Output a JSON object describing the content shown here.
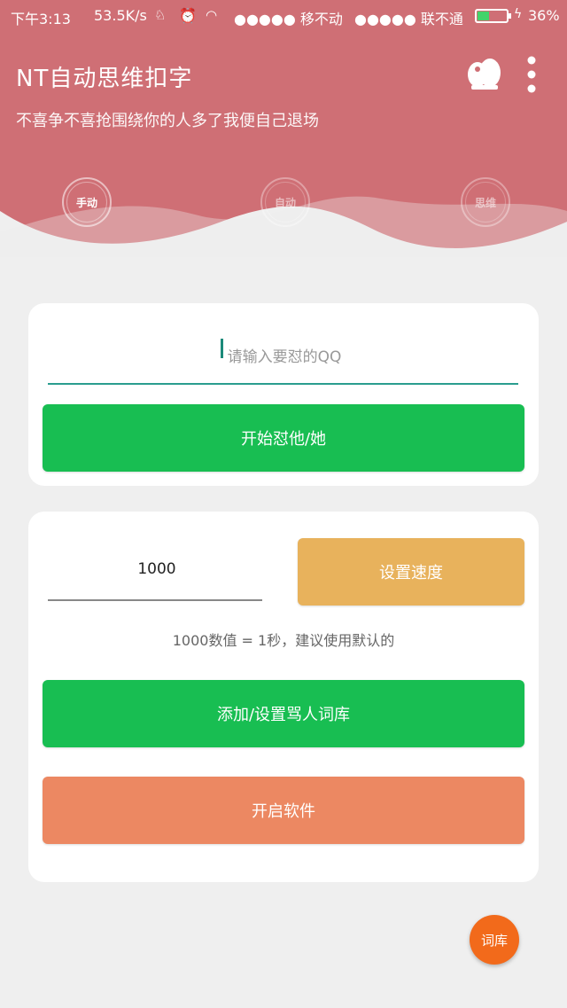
{
  "status_bar": {
    "time": "下午3:13",
    "speed": "53.5K/s",
    "carrier1": "●●●●● 移不动",
    "carrier2": "●●●●● 联不通",
    "battery": "36%"
  },
  "header": {
    "title": "NT自动思维扣字",
    "subtitle": "不喜争不喜抢围绕你的人多了我便自己退场",
    "modes": [
      {
        "label": "手动",
        "active": true
      },
      {
        "label": "自动",
        "active": false
      },
      {
        "label": "思维",
        "active": false
      }
    ],
    "icons": [
      "qq-icon",
      "more-vertical-icon"
    ]
  },
  "card1": {
    "qq_placeholder": "请输入要怼的QQ",
    "start_button": "开始怼他/她"
  },
  "card2": {
    "speed_value": "1000",
    "set_speed_button": "设置速度",
    "hint": "1000数值 = 1秒，建议使用默认的",
    "words_button": "添加/设置骂人词库",
    "start_app_button": "开启软件"
  },
  "fab": {
    "label": "词库"
  },
  "colors": {
    "header": "#cf6f75",
    "green": "#18be52",
    "yellow": "#e8b25c",
    "orange": "#ec8862",
    "fab": "#f26a1b"
  }
}
